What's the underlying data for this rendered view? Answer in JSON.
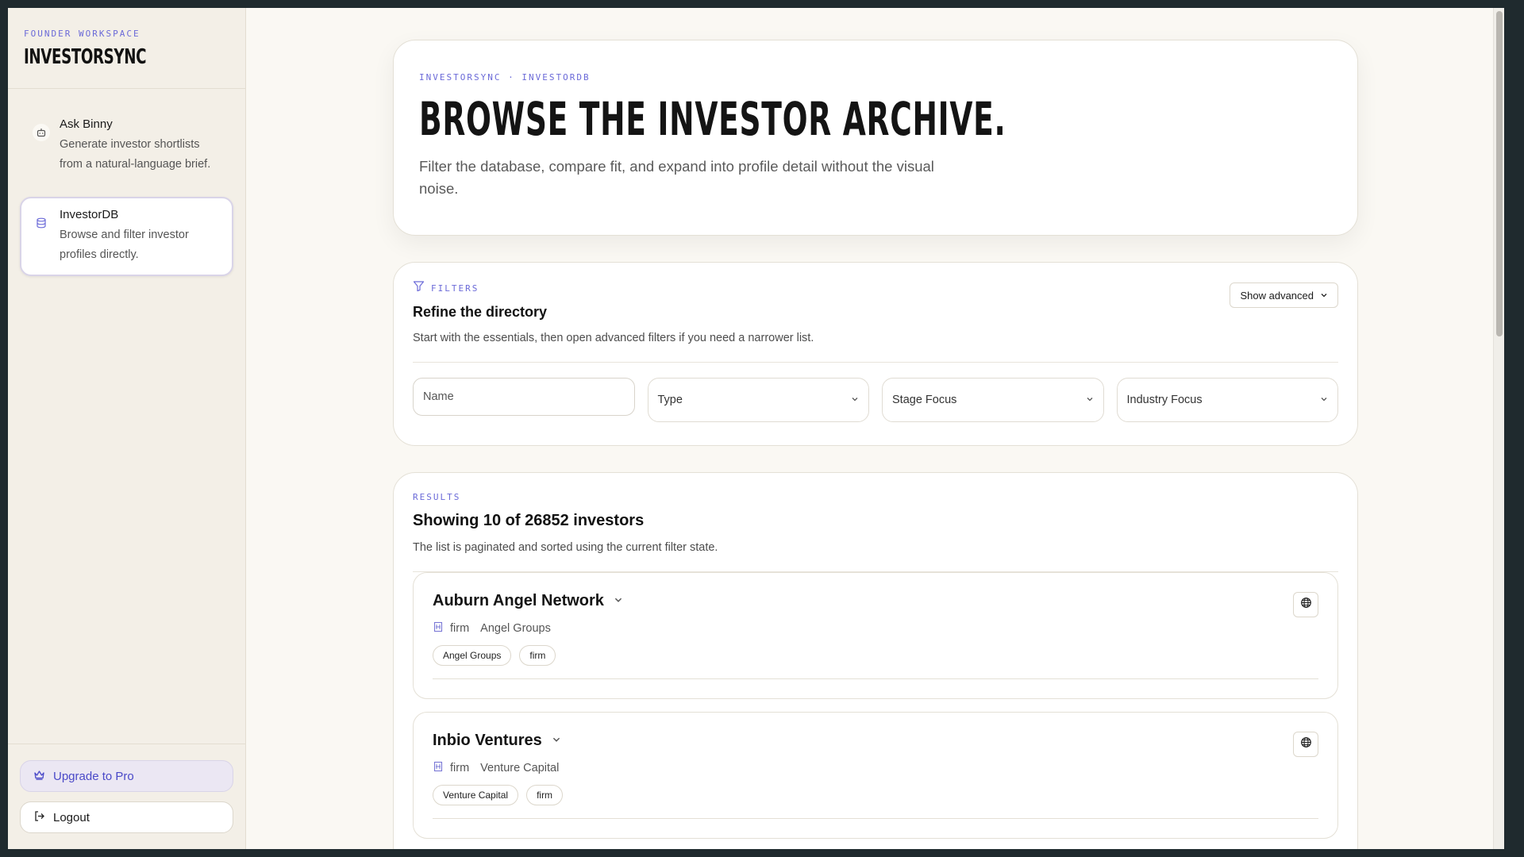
{
  "sidebar": {
    "eyebrow": "FOUNDER WORKSPACE",
    "brand": "INVESTORSYNC",
    "items": [
      {
        "title": "Ask Binny",
        "desc": "Generate investor shortlists from a natural-language brief.",
        "icon": "robot-icon"
      },
      {
        "title": "InvestorDB",
        "desc": "Browse and filter investor profiles directly.",
        "icon": "database-icon"
      }
    ],
    "upgrade_label": "Upgrade to Pro",
    "logout_label": "Logout"
  },
  "hero": {
    "eyebrow": "INVESTORSYNC · INVESTORDB",
    "title": "BROWSE THE INVESTOR ARCHIVE.",
    "subtitle": "Filter the database, compare fit, and expand into profile detail without the visual noise."
  },
  "filters": {
    "eyebrow": "FILTERS",
    "title": "Refine the directory",
    "desc": "Start with the essentials, then open advanced filters if you need a narrower list.",
    "show_advanced": "Show advanced",
    "name_placeholder": "Name",
    "type_label": "Type",
    "stage_label": "Stage Focus",
    "industry_label": "Industry Focus"
  },
  "results": {
    "eyebrow": "RESULTS",
    "title": "Showing 10 of 26852 investors",
    "desc": "The list is paginated and sorted using the current filter state.",
    "items": [
      {
        "name": "Auburn Angel Network",
        "kind": "firm",
        "category": "Angel Groups",
        "tags": [
          "Angel Groups",
          "firm"
        ]
      },
      {
        "name": "Inbio Ventures",
        "kind": "firm",
        "category": "Venture Capital",
        "tags": [
          "Venture Capital",
          "firm"
        ]
      }
    ]
  },
  "colors": {
    "accent": "#6b6ad8",
    "background": "#faf8f3",
    "sidebar": "#f3efe7"
  }
}
